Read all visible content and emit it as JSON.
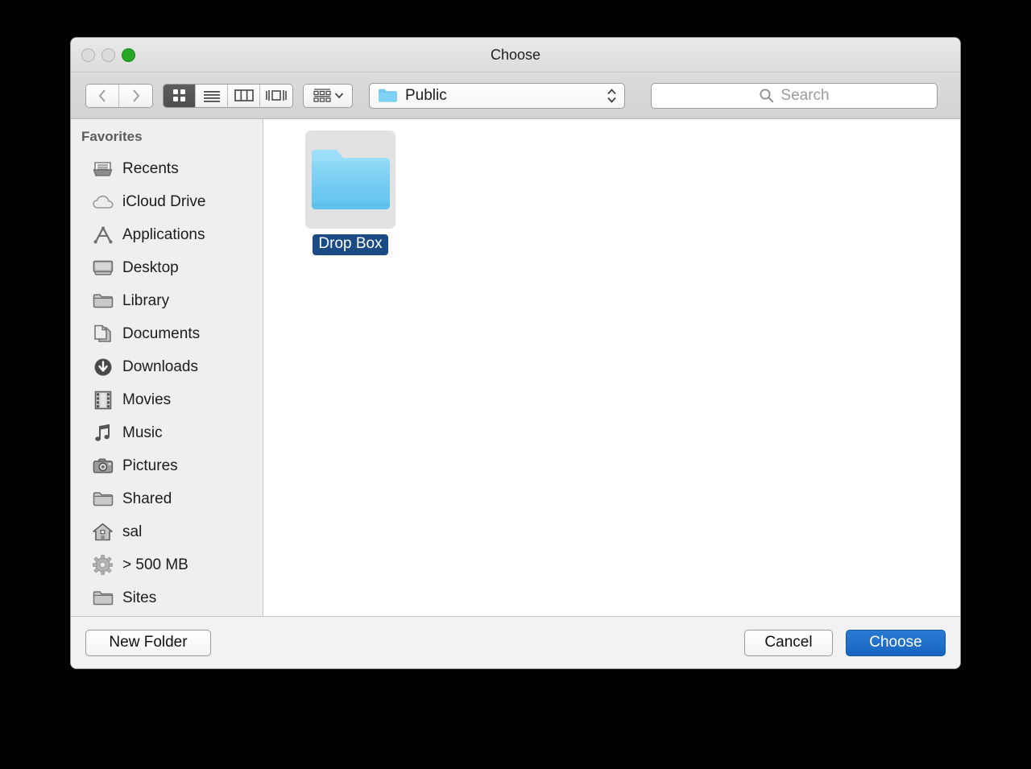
{
  "window": {
    "title": "Choose",
    "traffic_lights": [
      {
        "name": "close",
        "state": "disabled"
      },
      {
        "name": "minimize",
        "state": "disabled"
      },
      {
        "name": "zoom",
        "state": "green",
        "color": "#25a625"
      }
    ]
  },
  "toolbar": {
    "back_label": "‹",
    "forward_label": "›",
    "view_modes": [
      {
        "name": "icon-view",
        "selected": true
      },
      {
        "name": "list-view",
        "selected": false
      },
      {
        "name": "column-view",
        "selected": false
      },
      {
        "name": "coverflow-view",
        "selected": false
      }
    ],
    "arrange_label": "",
    "path": {
      "name": "Public",
      "icon": "blue-folder-icon"
    },
    "search": {
      "placeholder": "Search",
      "value": ""
    }
  },
  "sidebar": {
    "header": "Favorites",
    "items": [
      {
        "label": "Recents",
        "icon": "recents-tray-icon"
      },
      {
        "label": "iCloud Drive",
        "icon": "cloud-icon"
      },
      {
        "label": "Applications",
        "icon": "applications-icon"
      },
      {
        "label": "Desktop",
        "icon": "desktop-monitor-icon"
      },
      {
        "label": "Library",
        "icon": "folder-icon"
      },
      {
        "label": "Documents",
        "icon": "documents-pages-icon"
      },
      {
        "label": "Downloads",
        "icon": "download-circle-icon"
      },
      {
        "label": "Movies",
        "icon": "film-strip-icon"
      },
      {
        "label": "Music",
        "icon": "music-note-icon"
      },
      {
        "label": "Pictures",
        "icon": "camera-icon"
      },
      {
        "label": "Shared",
        "icon": "folder-icon"
      },
      {
        "label": "sal",
        "icon": "home-house-icon"
      },
      {
        "label": "> 500 MB",
        "icon": "gear-icon"
      },
      {
        "label": "Sites",
        "icon": "folder-icon"
      }
    ]
  },
  "file_area": {
    "items": [
      {
        "name": "Drop Box",
        "icon": "blue-folder-icon",
        "selected": true
      }
    ],
    "selection_color": "#1b4b85"
  },
  "footer": {
    "new_folder_label": "New Folder",
    "cancel_label": "Cancel",
    "choose_label": "Choose",
    "primary_color": "#1765c0"
  }
}
